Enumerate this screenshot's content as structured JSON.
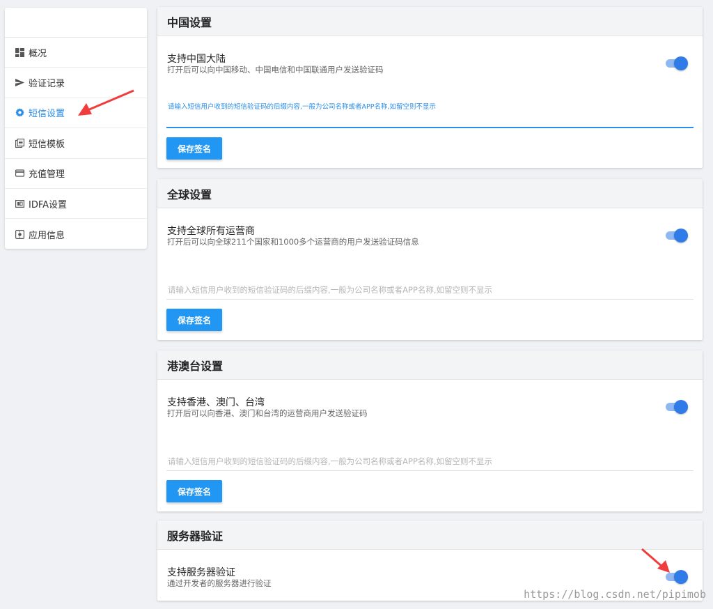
{
  "sidebar": {
    "items": [
      {
        "label": "概况",
        "icon": "dashboard-icon"
      },
      {
        "label": "验证记录",
        "icon": "send-icon"
      },
      {
        "label": "短信设置",
        "icon": "gear-icon",
        "active": true
      },
      {
        "label": "短信模板",
        "icon": "template-icon"
      },
      {
        "label": "充值管理",
        "icon": "card-icon"
      },
      {
        "label": "IDFA设置",
        "icon": "idfa-icon"
      },
      {
        "label": "应用信息",
        "icon": "app-icon"
      }
    ]
  },
  "sections": {
    "china": {
      "title": "中国设置",
      "toggle_title": "支持中国大陆",
      "toggle_desc": "打开后可以向中国移动、中国电信和中国联通用户发送验证码",
      "toggle_on": true,
      "input_label": "请输入短信用户收到的短信验证码的后缀内容,一般为公司名称或者APP名称,如留空则不显示",
      "input_value": "",
      "save_label": "保存签名"
    },
    "global": {
      "title": "全球设置",
      "toggle_title": "支持全球所有运营商",
      "toggle_desc": "打开后可以向全球211个国家和1000多个运营商的用户发送验证码信息",
      "toggle_on": true,
      "input_placeholder": "请输入短信用户收到的短信验证码的后缀内容,一般为公司名称或者APP名称,如留空则不显示",
      "save_label": "保存签名"
    },
    "hkmotw": {
      "title": "港澳台设置",
      "toggle_title": "支持香港、澳门、台湾",
      "toggle_desc": "打开后可以向香港、澳门和台湾的运营商用户发送验证码",
      "toggle_on": true,
      "input_placeholder": "请输入短信用户收到的短信验证码的后缀内容,一般为公司名称或者APP名称,如留空则不显示",
      "save_label": "保存签名"
    },
    "server": {
      "title": "服务器验证",
      "toggle_title": "支持服务器验证",
      "toggle_desc": "通过开发者的服务器进行验证",
      "toggle_on": true
    }
  },
  "watermark": "https://blog.csdn.net/pipimob",
  "colors": {
    "accent": "#2a8de6",
    "button": "#2196f3",
    "toggle_knob": "#2f7be8",
    "toggle_track": "#8fb8f2",
    "arrow": "#f03c3c"
  }
}
